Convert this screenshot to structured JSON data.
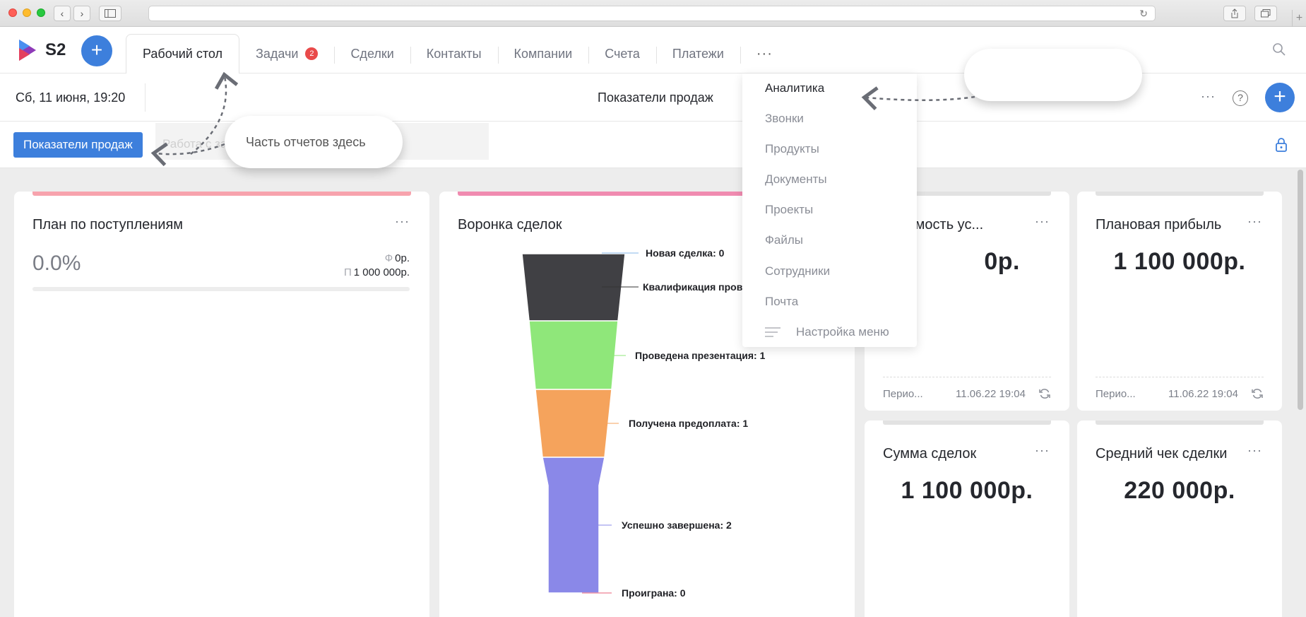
{
  "browser": {
    "back_glyph": "‹",
    "forward_glyph": "›",
    "reload_glyph": "↻",
    "new_tab_glyph": "+"
  },
  "app": {
    "logo_text": "S2",
    "add_glyph": "+",
    "brand_color": "#3d7fdc"
  },
  "tabs": [
    {
      "label": "Рабочий стол",
      "active": true
    },
    {
      "label": "Задачи",
      "badge": "2"
    },
    {
      "label": "Сделки"
    },
    {
      "label": "Контакты"
    },
    {
      "label": "Компании"
    },
    {
      "label": "Счета"
    },
    {
      "label": "Платежи"
    }
  ],
  "tabs_more": "···",
  "toolbar": {
    "date": "Сб, 11 июня, 19:20",
    "page_title": "Показатели продаж",
    "more": "···",
    "help": "?",
    "add": "+"
  },
  "reports": {
    "active_label": "Показатели продаж",
    "ghost_label": "Работа с за"
  },
  "dropdown": {
    "items": [
      "Аналитика",
      "Звонки",
      "Продукты",
      "Документы",
      "Проекты",
      "Файлы",
      "Сотрудники",
      "Почта"
    ],
    "settings_label": "Настройка меню"
  },
  "callouts": {
    "reports_hint": "Часть отчетов здесь",
    "empty_hint": ""
  },
  "widgets": {
    "plan": {
      "title": "План по поступлениям",
      "dots": "···",
      "percent": "0.0%",
      "fact_label": "Ф",
      "fact_value": "0р.",
      "plan_label": "П",
      "plan_value": "1 000 000р.",
      "progress_fraction": 0.0
    },
    "funnel": {
      "title": "Воронка сделок",
      "dots": "···"
    },
    "cost": {
      "title": "Стоимость ус...",
      "dots": "···",
      "value": "0р.",
      "foot_label": "Перио...",
      "foot_time": "11.06.22 19:04"
    },
    "profit": {
      "title": "Плановая прибыль",
      "dots": "···",
      "value": "1 100 000р.",
      "foot_label": "Перио...",
      "foot_time": "11.06.22 19:04"
    },
    "sum": {
      "title": "Сумма сделок",
      "dots": "···",
      "value": "1 100 000р."
    },
    "avg": {
      "title": "Средний чек сделки",
      "dots": "···",
      "value": "220 000р."
    }
  },
  "chart_data": {
    "type": "funnel",
    "title": "Воронка сделок",
    "stages": [
      {
        "label": "Новая сделка: 0",
        "value": 0,
        "color": "#404044"
      },
      {
        "label": "Квалификация пров",
        "value": null,
        "color": "#404044"
      },
      {
        "label": "Проведена презентация: 1",
        "value": 1,
        "color": "#8fe77a"
      },
      {
        "label": "Получена предоплата: 1",
        "value": 1,
        "color": "#f5a35c"
      },
      {
        "label": "Успешно завершена: 2",
        "value": 2,
        "color": "#8a88e8"
      },
      {
        "label": "Проиграна: 0",
        "value": 0,
        "color": "#e8607a"
      }
    ]
  },
  "colors": {
    "plan_bar": "#f7a3ad",
    "funnel_bar": "#f08bb0",
    "gray_bar": "#e2e2e2"
  }
}
